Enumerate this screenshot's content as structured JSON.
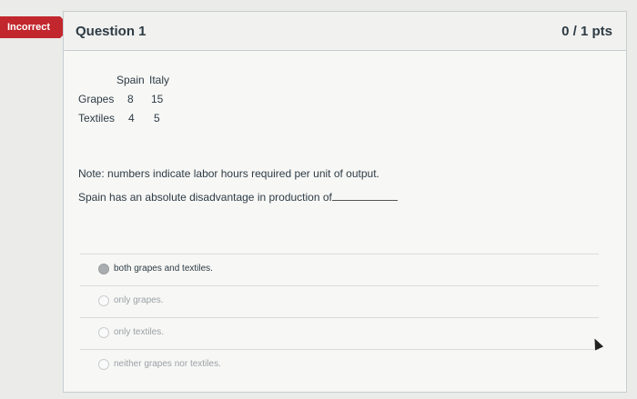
{
  "badge": {
    "label": "Incorrect",
    "color": "#c1272d"
  },
  "question": {
    "title": "Question 1",
    "points": "0 / 1 pts",
    "table": {
      "headers": [
        "Spain",
        "Italy"
      ],
      "rows": [
        {
          "label": "Grapes",
          "spain": "8",
          "italy": "15"
        },
        {
          "label": "Textiles",
          "spain": "4",
          "italy": "5"
        }
      ]
    },
    "note": "Note: numbers indicate labor hours required per unit of output.",
    "prompt": "Spain has an absolute disadvantage in production of"
  },
  "answers": [
    {
      "label": "both grapes and textiles.",
      "selected": true
    },
    {
      "label": "only grapes.",
      "selected": false
    },
    {
      "label": "only textiles.",
      "selected": false
    },
    {
      "label": "neither grapes nor textiles.",
      "selected": false
    }
  ]
}
